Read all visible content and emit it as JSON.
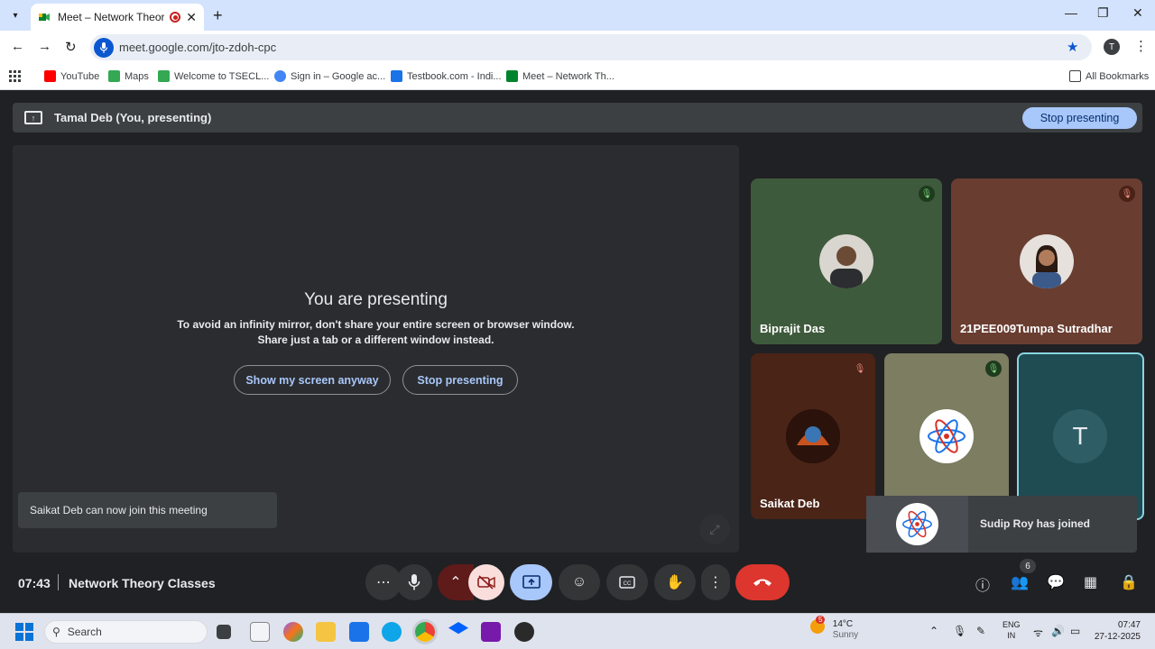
{
  "browser": {
    "tab_title": "Meet – Network Theory Cla",
    "url": "meet.google.com/jto-zdoh-cpc",
    "profile_initial": "T",
    "bookmarks": [
      {
        "label": "YouTube",
        "color": "#ff0000"
      },
      {
        "label": "Maps",
        "color": "#34a853"
      },
      {
        "label": "Welcome to TSECL...",
        "color": "#34a853"
      },
      {
        "label": "Sign in – Google ac...",
        "color": "#4285f4"
      },
      {
        "label": "Testbook.com - Indi...",
        "color": "#1a73e8"
      },
      {
        "label": "Meet – Network Th...",
        "color": "#00832d"
      }
    ],
    "all_bookmarks": "All Bookmarks"
  },
  "presenting_bar": {
    "name": "Tamal Deb (You, presenting)",
    "stop_label": "Stop presenting"
  },
  "stage": {
    "title": "You are presenting",
    "message_line1": "To avoid an infinity mirror, don't share your entire screen or browser window.",
    "message_line2": "Share just a tab or a different window instead.",
    "show_anyway": "Show my screen anyway",
    "stop": "Stop presenting"
  },
  "toast_left": "Saikat Deb can now join this meeting",
  "participants": {
    "p1": {
      "name": "Biprajit Das",
      "bg": "#3e5a3c"
    },
    "p2": {
      "name": "21PEE009Tumpa Sutradhar",
      "bg": "#6a3d31"
    },
    "p3": {
      "name": "Saikat Deb",
      "bg": "#4a2417"
    },
    "p4": {
      "name": "",
      "bg": "#7c7d61"
    },
    "p5": {
      "initial": "T",
      "bg": "#1f4b53"
    }
  },
  "toast_right": "Sudip Roy has joined",
  "meeting": {
    "time": "07:43",
    "name": "Network Theory Classes",
    "participant_count": "6"
  },
  "taskbar": {
    "search": "Search",
    "weather_temp": "14°C",
    "weather_desc": "Sunny",
    "weather_badge": "5",
    "lang1": "ENG",
    "lang2": "IN",
    "time": "07:47",
    "date": "27-12-2025"
  }
}
